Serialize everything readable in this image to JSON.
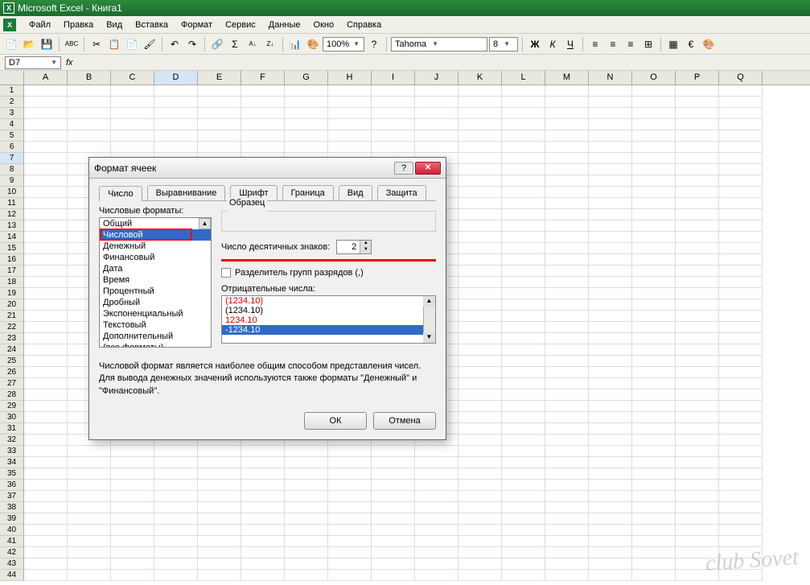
{
  "titlebar": {
    "app": "Microsoft Excel",
    "doc": "Книга1"
  },
  "menu": {
    "file": "Файл",
    "edit": "Правка",
    "view": "Вид",
    "insert": "Вставка",
    "format": "Формат",
    "tools": "Сервис",
    "data": "Данные",
    "window": "Окно",
    "help": "Справка"
  },
  "toolbar": {
    "zoom": "100%",
    "font": "Tahoma",
    "fontsize": "8"
  },
  "namebox": {
    "ref": "D7"
  },
  "cols": [
    "A",
    "B",
    "C",
    "D",
    "E",
    "F",
    "G",
    "H",
    "I",
    "J",
    "K",
    "L",
    "M",
    "N",
    "O",
    "P",
    "Q"
  ],
  "rows": [
    "1",
    "2",
    "3",
    "4",
    "5",
    "6",
    "7",
    "8",
    "9",
    "10",
    "11",
    "12",
    "13",
    "14",
    "15",
    "16",
    "17",
    "18",
    "19",
    "20",
    "21",
    "22",
    "23",
    "24",
    "25",
    "26",
    "27",
    "28",
    "29",
    "30",
    "31",
    "32",
    "33",
    "34",
    "35",
    "36",
    "37",
    "38",
    "39",
    "40",
    "41",
    "42",
    "43",
    "44"
  ],
  "dialog": {
    "title": "Формат ячеек",
    "tabs": {
      "number": "Число",
      "align": "Выравнивание",
      "font": "Шрифт",
      "border": "Граница",
      "fill": "Вид",
      "protect": "Защита"
    },
    "formats_label": "Числовые форматы:",
    "formats": [
      "Общий",
      "Числовой",
      "Денежный",
      "Финансовый",
      "Дата",
      "Время",
      "Процентный",
      "Дробный",
      "Экспоненциальный",
      "Текстовый",
      "Дополнительный",
      "(все форматы)"
    ],
    "formats_selected": "Числовой",
    "sample_label": "Образец",
    "decimals_label": "Число десятичных знаков:",
    "decimals_value": "2",
    "thousands_label": "Разделитель групп разрядов (,)",
    "negative_label": "Отрицательные числа:",
    "negatives": [
      "-1234.10",
      "1234.10",
      "(1234.10)",
      "(1234.10)"
    ],
    "desc_line1": "Числовой формат является наиболее общим способом представления чисел.",
    "desc_line2": "Для вывода денежных значений используются также форматы \"Денежный\" и \"Финансовый\".",
    "ok": "ОК",
    "cancel": "Отмена"
  },
  "watermark": "club Sovet"
}
